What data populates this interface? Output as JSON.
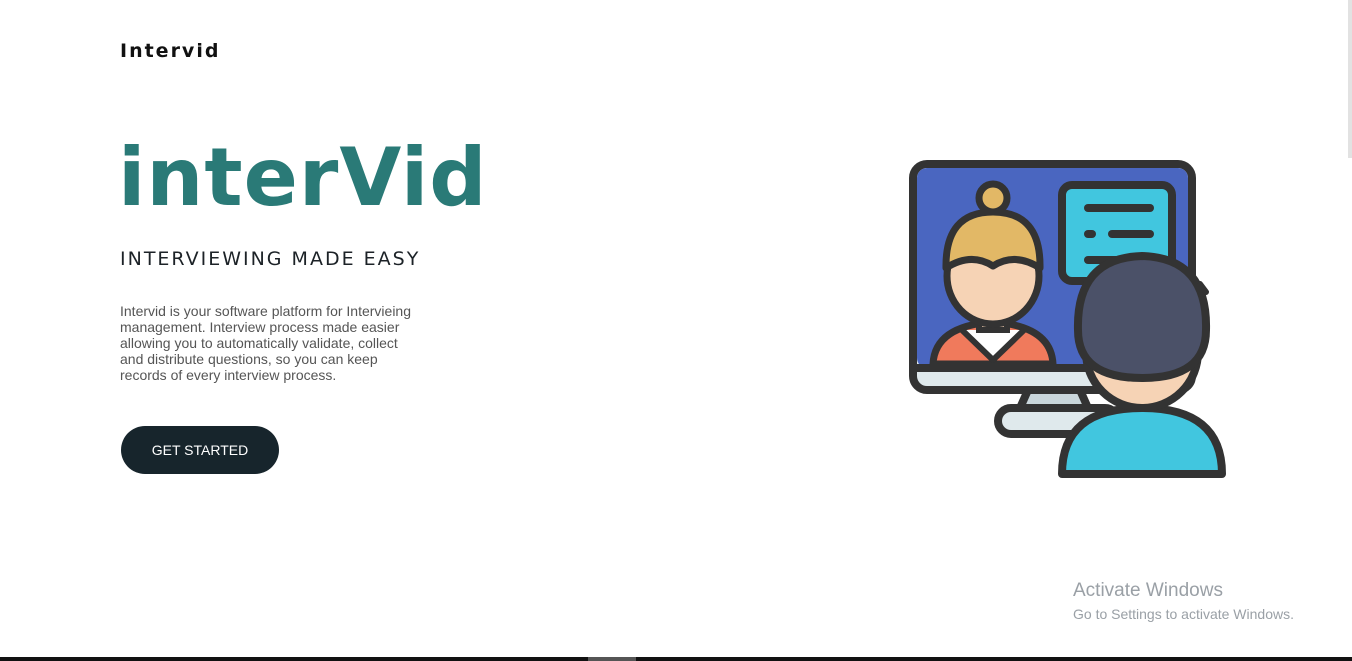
{
  "nav": {
    "brand": "Intervid"
  },
  "hero": {
    "title": "interVid",
    "tagline": "INTERVIEWING MADE EASY",
    "description": "Intervid is your software platform for Intervieing management. Interview process made easier allowing you to automatically validate, collect and distribute questions, so you can keep records of every interview process.",
    "cta_label": "GET STARTED"
  },
  "illustration": {
    "icon": "video-interview-illustration"
  },
  "watermark": {
    "title": "Activate Windows",
    "subtitle": "Go to Settings to activate Windows."
  },
  "colors": {
    "accent": "#2a7a77",
    "button_bg": "#17252c",
    "screen_blue": "#4a66c0",
    "cyan": "#41c6df",
    "dark_outline": "#333333"
  }
}
